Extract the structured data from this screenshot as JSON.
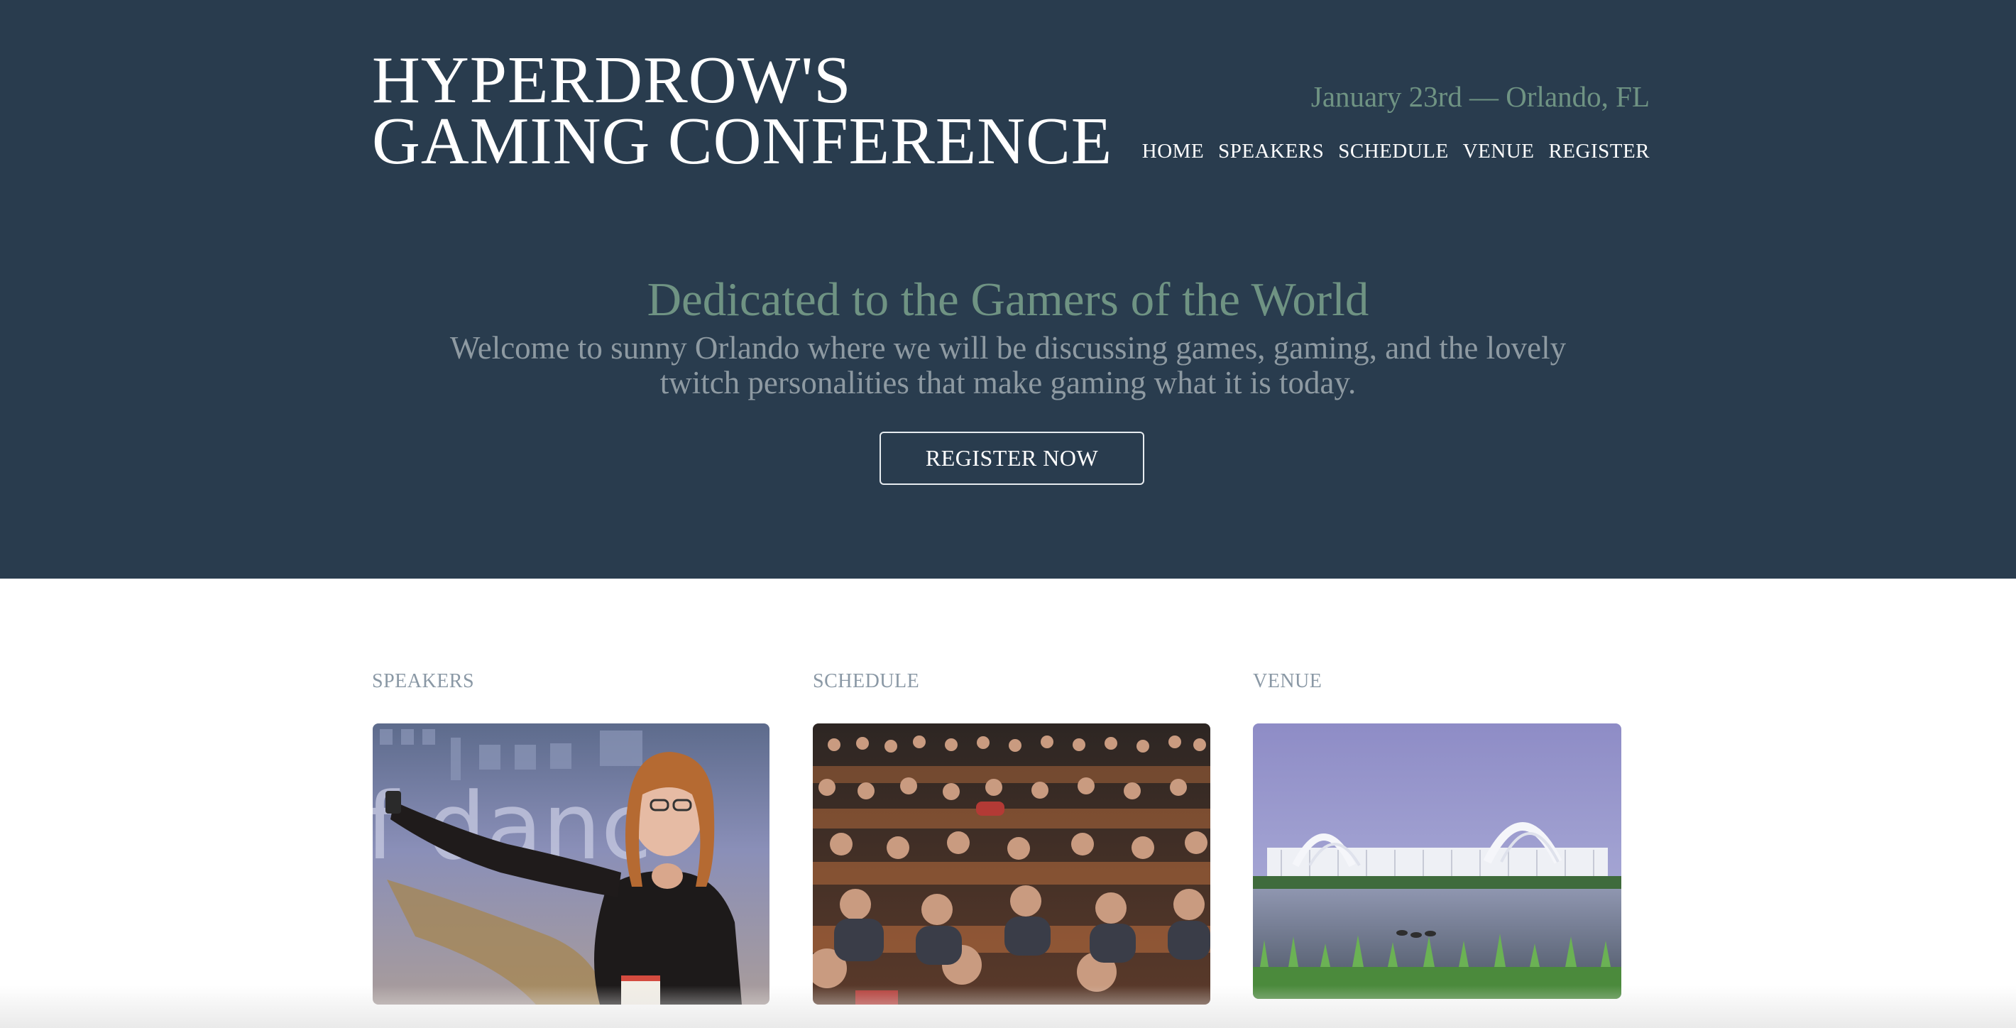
{
  "header": {
    "title_line1": "HYPERDROW'S",
    "title_line2": "GAMING CONFERENCE",
    "event_meta": "January 23rd — Orlando, FL",
    "nav": [
      {
        "label": "HOME"
      },
      {
        "label": "SPEAKERS"
      },
      {
        "label": "SCHEDULE"
      },
      {
        "label": "VENUE"
      },
      {
        "label": "REGISTER"
      }
    ]
  },
  "hero": {
    "tagline": "Dedicated to the Gamers of the World",
    "welcome": "Welcome to sunny Orlando where we will be discussing games, gaming, and the lovely twitch personalities that make gaming what it is today.",
    "cta_label": "REGISTER NOW"
  },
  "sections": [
    {
      "heading": "SPEAKERS",
      "image": "speaker-presenting-photo"
    },
    {
      "heading": "SCHEDULE",
      "image": "audience-seated-photo"
    },
    {
      "heading": "VENUE",
      "image": "convention-center-photo"
    }
  ],
  "colors": {
    "hero_background": "#293c4e",
    "accent_green": "#6f9383",
    "muted_text": "#8e9aa2",
    "section_heading": "#8a98a5"
  }
}
